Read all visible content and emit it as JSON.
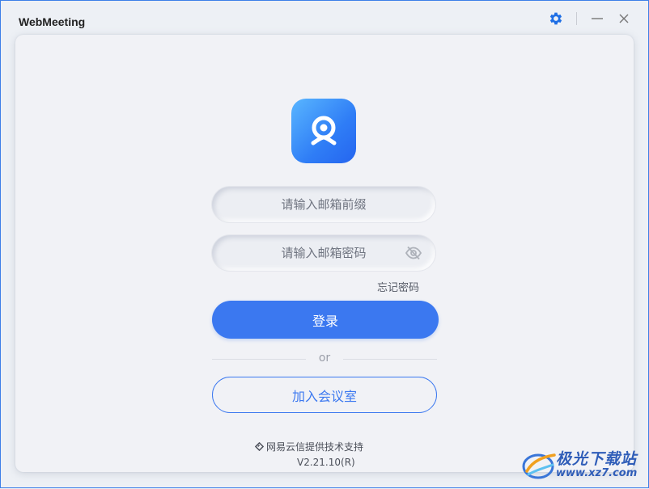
{
  "window": {
    "title": "WebMeeting"
  },
  "titlebar": {
    "settings_icon": "gear-icon",
    "minimize_icon": "minimize-icon",
    "close_icon": "close-icon",
    "accent": "#1f6fe5"
  },
  "login": {
    "logo_icon": "webcam-logo-icon",
    "email_placeholder": "请输入邮箱前缀",
    "email_value": "",
    "password_placeholder": "请输入邮箱密码",
    "password_value": "",
    "password_toggle_icon": "eye-off-icon",
    "forgot_label": "忘记密码",
    "login_label": "登录",
    "or_label": "or",
    "join_label": "加入会议室",
    "primary_color": "#3b78f0"
  },
  "footer": {
    "powered_by": "网易云信提供技术支持",
    "powered_icon": "netease-yunxin-logo-icon",
    "version": "V2.21.10(R)"
  },
  "watermark": {
    "name": "极光下载站",
    "url": "www.xz7.com"
  }
}
